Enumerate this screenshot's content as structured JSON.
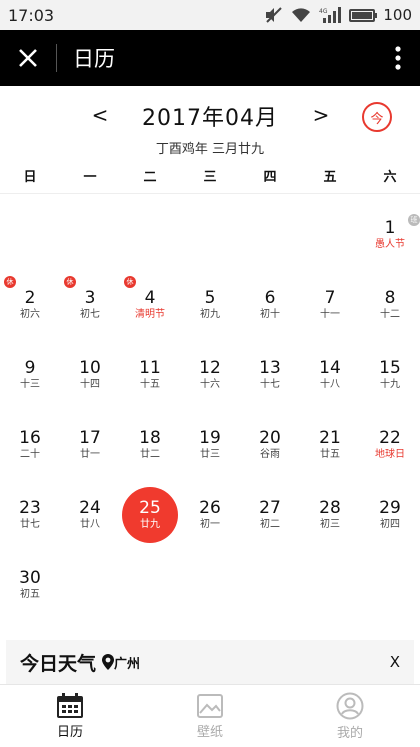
{
  "status_bar": {
    "time": "17:03",
    "battery": "100",
    "network": "4G"
  },
  "app_bar": {
    "title": "日历"
  },
  "month": {
    "title": "2017年04月",
    "lunar": "丁酉鸡年 三月廿九",
    "prev": "<",
    "next": ">",
    "today_label": "今"
  },
  "weekdays": [
    "日",
    "一",
    "二",
    "三",
    "四",
    "五",
    "六"
  ],
  "badges": {
    "rest": "休",
    "work": "班"
  },
  "days": [
    {
      "num": "",
      "lunar": ""
    },
    {
      "num": "",
      "lunar": ""
    },
    {
      "num": "",
      "lunar": ""
    },
    {
      "num": "",
      "lunar": ""
    },
    {
      "num": "",
      "lunar": ""
    },
    {
      "num": "",
      "lunar": ""
    },
    {
      "num": "1",
      "lunar": "愚人节",
      "festival": true,
      "badge": "work"
    },
    {
      "num": "2",
      "lunar": "初六",
      "badge": "rest"
    },
    {
      "num": "3",
      "lunar": "初七",
      "badge": "rest"
    },
    {
      "num": "4",
      "lunar": "清明节",
      "festival": true,
      "badge": "rest"
    },
    {
      "num": "5",
      "lunar": "初九"
    },
    {
      "num": "6",
      "lunar": "初十"
    },
    {
      "num": "7",
      "lunar": "十一"
    },
    {
      "num": "8",
      "lunar": "十二"
    },
    {
      "num": "9",
      "lunar": "十三"
    },
    {
      "num": "10",
      "lunar": "十四"
    },
    {
      "num": "11",
      "lunar": "十五"
    },
    {
      "num": "12",
      "lunar": "十六"
    },
    {
      "num": "13",
      "lunar": "十七"
    },
    {
      "num": "14",
      "lunar": "十八"
    },
    {
      "num": "15",
      "lunar": "十九"
    },
    {
      "num": "16",
      "lunar": "二十"
    },
    {
      "num": "17",
      "lunar": "廿一"
    },
    {
      "num": "18",
      "lunar": "廿二"
    },
    {
      "num": "19",
      "lunar": "廿三"
    },
    {
      "num": "20",
      "lunar": "谷雨"
    },
    {
      "num": "21",
      "lunar": "廿五"
    },
    {
      "num": "22",
      "lunar": "地球日",
      "festival": true
    },
    {
      "num": "23",
      "lunar": "廿七"
    },
    {
      "num": "24",
      "lunar": "廿八"
    },
    {
      "num": "25",
      "lunar": "廿九",
      "selected": true
    },
    {
      "num": "26",
      "lunar": "初一"
    },
    {
      "num": "27",
      "lunar": "初二"
    },
    {
      "num": "28",
      "lunar": "初三"
    },
    {
      "num": "29",
      "lunar": "初四"
    },
    {
      "num": "30",
      "lunar": "初五"
    }
  ],
  "weather": {
    "title": "今日天气",
    "location": "广州",
    "close": "X"
  },
  "nav": [
    {
      "label": "日历",
      "icon": "calendar-icon",
      "active": true
    },
    {
      "label": "壁纸",
      "icon": "wallpaper-icon",
      "active": false
    },
    {
      "label": "我的",
      "icon": "profile-icon",
      "active": false
    }
  ],
  "colors": {
    "accent": "#f03a2e",
    "app_bar": "#000000"
  }
}
